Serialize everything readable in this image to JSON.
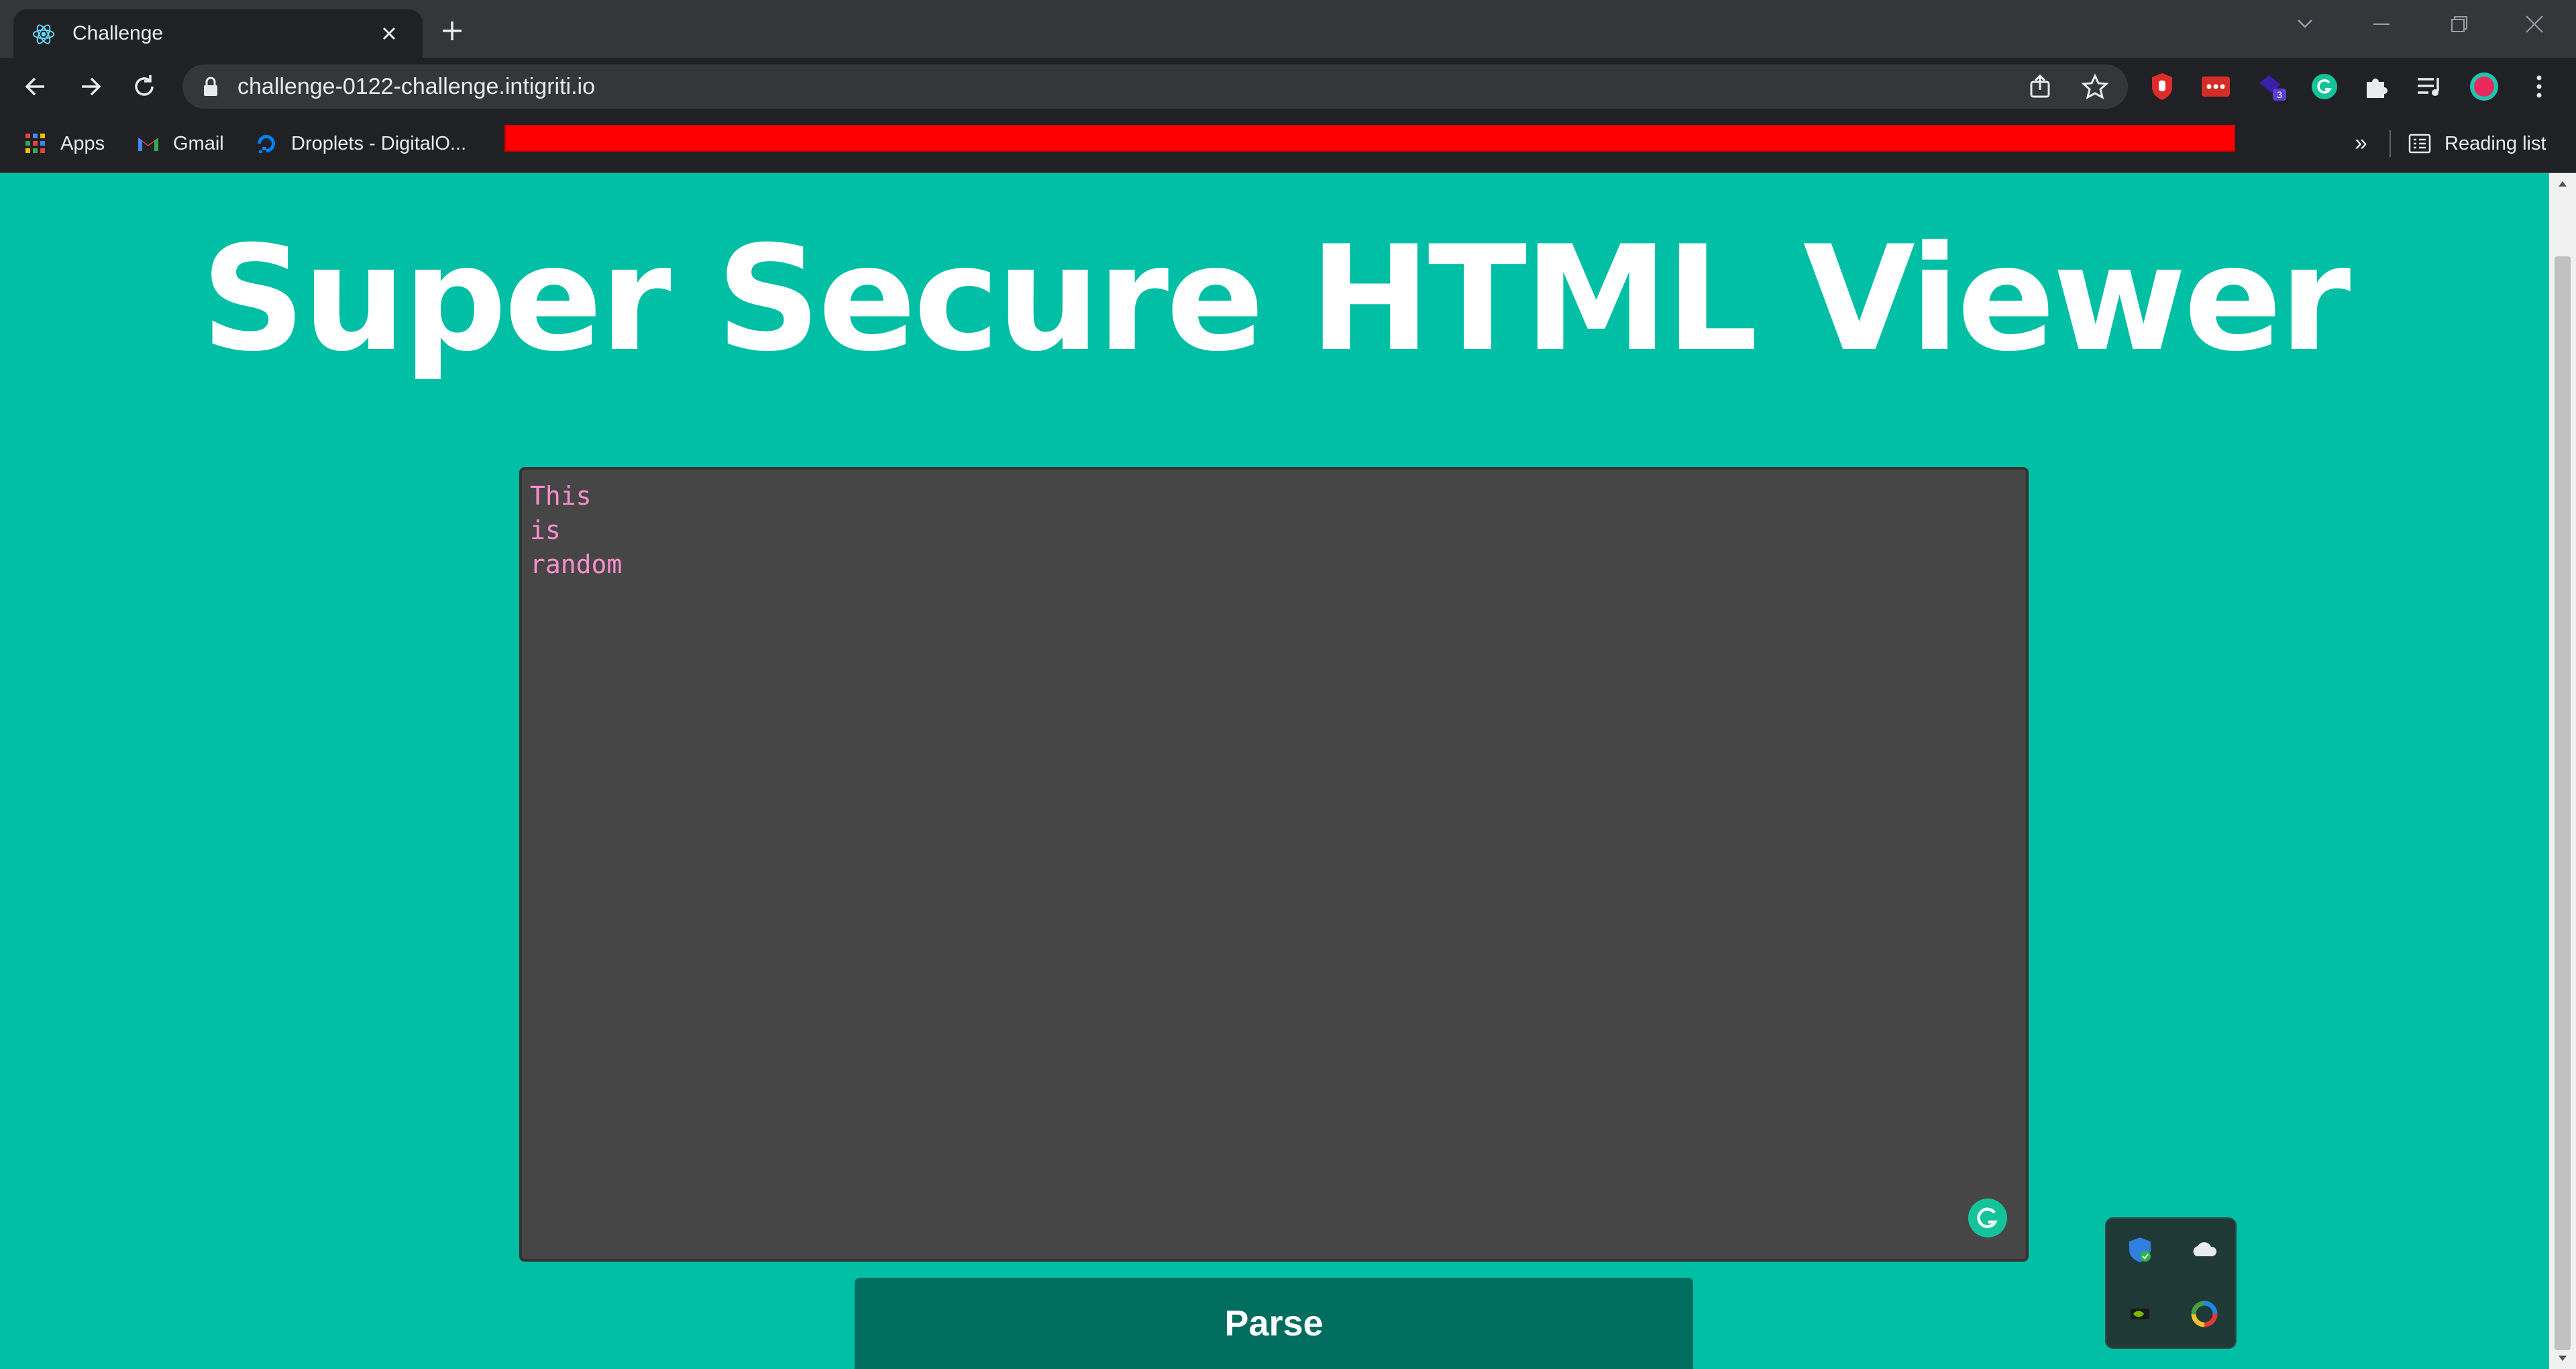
{
  "browser": {
    "tab_title": "Challenge",
    "url": "challenge-0122-challenge.intigriti.io",
    "bookmarks": [
      {
        "label": "Apps",
        "icon": "apps-grid-icon"
      },
      {
        "label": "Gmail",
        "icon": "gmail-icon"
      },
      {
        "label": "Droplets - DigitalO...",
        "icon": "digitalocean-icon"
      }
    ],
    "bookmarks_overflow": "»",
    "reading_list": "Reading list",
    "extension_badge": "3"
  },
  "page": {
    "heading": "Super Secure HTML Viewer",
    "editor_text": "This\nis\nrandom",
    "parse_label": "Parse"
  },
  "colors": {
    "page_bg": "#00bfa5",
    "editor_bg": "#464646",
    "editor_text": "#ff8fcf",
    "button_bg": "#006d5f",
    "bookmark_highlight": "#ff0000"
  }
}
